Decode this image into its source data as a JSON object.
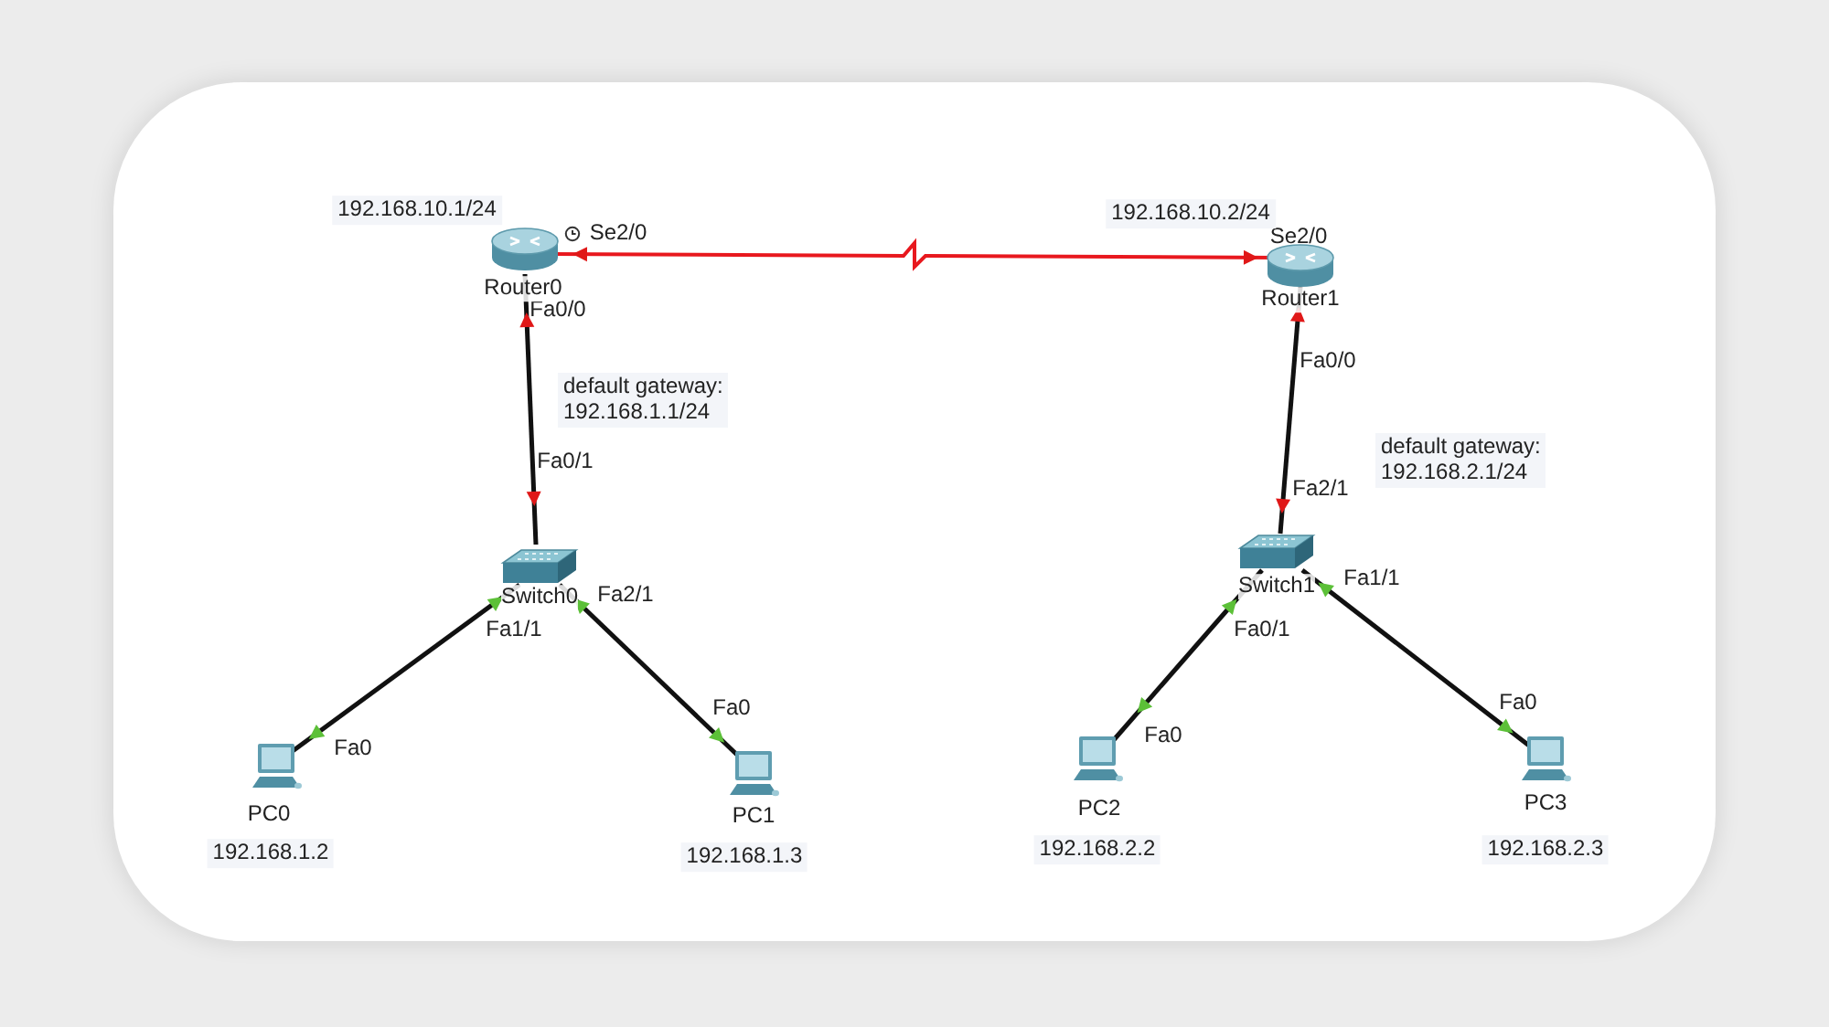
{
  "devices": [
    {
      "kind": "router",
      "name": "Router0",
      "address": "192.168.10.1/24"
    },
    {
      "kind": "router",
      "name": "Router1",
      "address": "192.168.10.2/24"
    },
    {
      "kind": "switch",
      "name": "Switch0"
    },
    {
      "kind": "switch",
      "name": "Switch1"
    },
    {
      "kind": "pc",
      "name": "PC0",
      "address": "192.168.1.2"
    },
    {
      "kind": "pc",
      "name": "PC1",
      "address": "192.168.1.3"
    },
    {
      "kind": "pc",
      "name": "PC2",
      "address": "192.168.2.2"
    },
    {
      "kind": "pc",
      "name": "PC3",
      "address": "192.168.2.3"
    }
  ],
  "links": [
    {
      "kind": "serial",
      "a_port": "Se2/0",
      "b_port": "Se2/0",
      "a_up": false,
      "b_up": false,
      "a_clock": true
    },
    {
      "kind": "ethernet",
      "a_port": "Fa0/0",
      "b_port": "Fa0/1",
      "a_up": false,
      "b_up": false
    },
    {
      "kind": "ethernet",
      "a_port": "Fa0/0",
      "b_port": "Fa2/1",
      "a_up": false,
      "b_up": false
    },
    {
      "kind": "ethernet",
      "a_port": "Fa1/1",
      "b_port": "Fa0",
      "a_up": true,
      "b_up": true
    },
    {
      "kind": "ethernet",
      "a_port": "Fa2/1",
      "b_port": "Fa0",
      "a_up": true,
      "b_up": true
    },
    {
      "kind": "ethernet",
      "a_port": "Fa0/1",
      "b_port": "Fa0",
      "a_up": true,
      "b_up": true
    },
    {
      "kind": "ethernet",
      "a_port": "Fa1/1",
      "b_port": "Fa0",
      "a_up": true,
      "b_up": true
    }
  ],
  "notes": [
    {
      "lines": [
        "default gateway:",
        "192.168.1.1/24"
      ]
    },
    {
      "lines": [
        "default gateway:",
        "192.168.2.1/24"
      ]
    }
  ]
}
